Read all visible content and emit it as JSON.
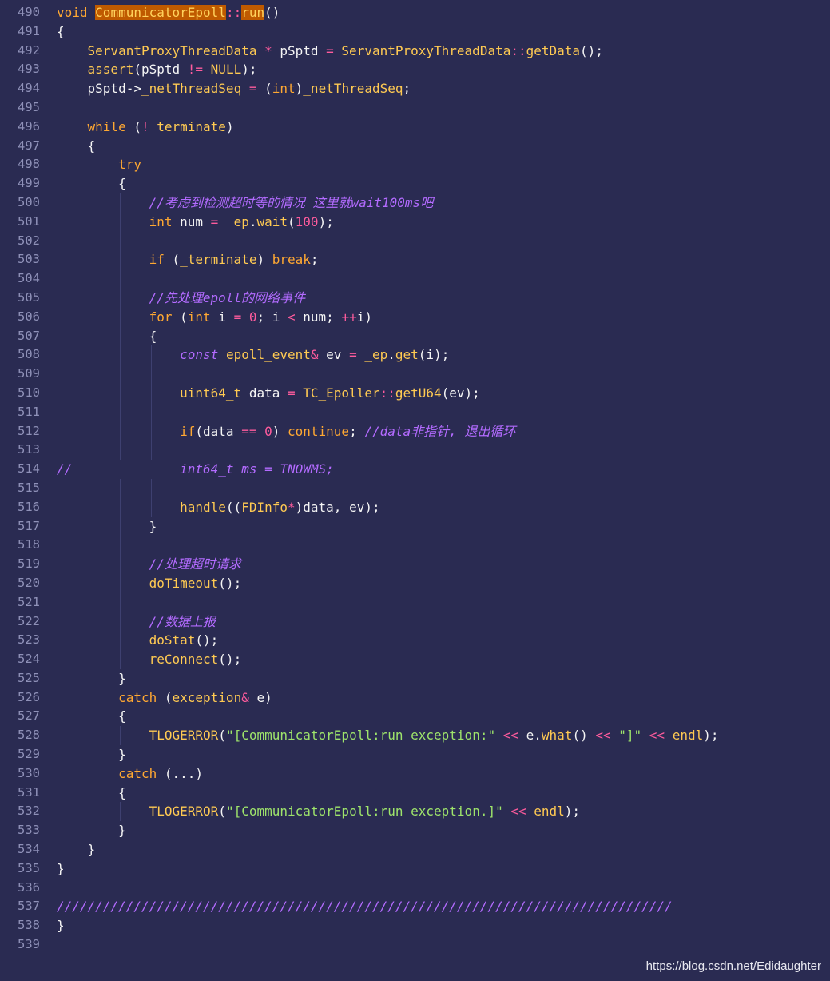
{
  "editor": {
    "background": "#2a2b52",
    "lines": [
      {
        "num": "490",
        "indent": 0,
        "tokens": [
          [
            "void ",
            "kw"
          ],
          [
            "CommunicatorEpoll",
            "hl"
          ],
          [
            "::",
            "op"
          ],
          [
            "run",
            "hl"
          ],
          [
            "()",
            "punct"
          ]
        ]
      },
      {
        "num": "491",
        "indent": 0,
        "tokens": [
          [
            "{",
            "punct"
          ]
        ]
      },
      {
        "num": "492",
        "indent": 1,
        "tokens": [
          [
            "    ",
            "plain"
          ],
          [
            "ServantProxyThreadData",
            "fn"
          ],
          [
            " * ",
            "op"
          ],
          [
            "pSptd ",
            "plain"
          ],
          [
            "= ",
            "op"
          ],
          [
            "ServantProxyThreadData",
            "fn"
          ],
          [
            "::",
            "op"
          ],
          [
            "getData",
            "fn"
          ],
          [
            "();",
            "punct"
          ]
        ]
      },
      {
        "num": "493",
        "indent": 1,
        "tokens": [
          [
            "    ",
            "plain"
          ],
          [
            "assert",
            "fn"
          ],
          [
            "(pSptd ",
            "plain"
          ],
          [
            "!= ",
            "op"
          ],
          [
            "NULL",
            "fn"
          ],
          [
            ");",
            "punct"
          ]
        ]
      },
      {
        "num": "494",
        "indent": 1,
        "tokens": [
          [
            "    ",
            "plain"
          ],
          [
            "pSptd->",
            "plain"
          ],
          [
            "_netThreadSeq",
            "fn"
          ],
          [
            " = ",
            "op"
          ],
          [
            "(",
            "punct"
          ],
          [
            "int",
            "type"
          ],
          [
            ")",
            "punct"
          ],
          [
            "_netThreadSeq",
            "fn"
          ],
          [
            ";",
            "punct"
          ]
        ]
      },
      {
        "num": "495",
        "indent": 0,
        "tokens": []
      },
      {
        "num": "496",
        "indent": 1,
        "tokens": [
          [
            "    ",
            "plain"
          ],
          [
            "while",
            "kw"
          ],
          [
            " (",
            "punct"
          ],
          [
            "!",
            "op"
          ],
          [
            "_terminate",
            "fn"
          ],
          [
            ")",
            "punct"
          ]
        ]
      },
      {
        "num": "497",
        "indent": 1,
        "tokens": [
          [
            "    ",
            "plain"
          ],
          [
            "{",
            "punct"
          ]
        ]
      },
      {
        "num": "498",
        "indent": 2,
        "tokens": [
          [
            "        ",
            "plain"
          ],
          [
            "try",
            "kw"
          ]
        ]
      },
      {
        "num": "499",
        "indent": 2,
        "tokens": [
          [
            "        ",
            "plain"
          ],
          [
            "{",
            "punct"
          ]
        ]
      },
      {
        "num": "500",
        "indent": 3,
        "tokens": [
          [
            "            ",
            "plain"
          ],
          [
            "//考虑到检测超时等的情况 这里就wait100ms吧",
            "cmt"
          ]
        ]
      },
      {
        "num": "501",
        "indent": 3,
        "tokens": [
          [
            "            ",
            "plain"
          ],
          [
            "int",
            "type"
          ],
          [
            " num ",
            "plain"
          ],
          [
            "= ",
            "op"
          ],
          [
            "_ep",
            "fn"
          ],
          [
            ".",
            "punct"
          ],
          [
            "wait",
            "fn"
          ],
          [
            "(",
            "punct"
          ],
          [
            "100",
            "num"
          ],
          [
            ");",
            "punct"
          ]
        ]
      },
      {
        "num": "502",
        "indent": 3,
        "tokens": []
      },
      {
        "num": "503",
        "indent": 3,
        "tokens": [
          [
            "            ",
            "plain"
          ],
          [
            "if",
            "kw"
          ],
          [
            " (",
            "punct"
          ],
          [
            "_terminate",
            "fn"
          ],
          [
            ") ",
            "punct"
          ],
          [
            "break",
            "kw"
          ],
          [
            ";",
            "punct"
          ]
        ]
      },
      {
        "num": "504",
        "indent": 3,
        "tokens": []
      },
      {
        "num": "505",
        "indent": 3,
        "tokens": [
          [
            "            ",
            "plain"
          ],
          [
            "//先处理epoll的网络事件",
            "cmt"
          ]
        ]
      },
      {
        "num": "506",
        "indent": 3,
        "tokens": [
          [
            "            ",
            "plain"
          ],
          [
            "for",
            "kw"
          ],
          [
            " (",
            "punct"
          ],
          [
            "int",
            "type"
          ],
          [
            " i ",
            "plain"
          ],
          [
            "= ",
            "op"
          ],
          [
            "0",
            "num"
          ],
          [
            "; i ",
            "plain"
          ],
          [
            "< ",
            "op"
          ],
          [
            "num; ",
            "plain"
          ],
          [
            "++",
            "op"
          ],
          [
            "i)",
            "plain"
          ]
        ]
      },
      {
        "num": "507",
        "indent": 3,
        "tokens": [
          [
            "            ",
            "plain"
          ],
          [
            "{",
            "punct"
          ]
        ]
      },
      {
        "num": "508",
        "indent": 4,
        "tokens": [
          [
            "                ",
            "plain"
          ],
          [
            "const",
            "cmt"
          ],
          [
            " ",
            "plain"
          ],
          [
            "epoll_event",
            "fn"
          ],
          [
            "& ",
            "op"
          ],
          [
            "ev ",
            "plain"
          ],
          [
            "= ",
            "op"
          ],
          [
            "_ep",
            "fn"
          ],
          [
            ".",
            "punct"
          ],
          [
            "get",
            "fn"
          ],
          [
            "(i);",
            "punct"
          ]
        ]
      },
      {
        "num": "509",
        "indent": 4,
        "tokens": []
      },
      {
        "num": "510",
        "indent": 4,
        "tokens": [
          [
            "                ",
            "plain"
          ],
          [
            "uint64_t",
            "fn"
          ],
          [
            " data ",
            "plain"
          ],
          [
            "= ",
            "op"
          ],
          [
            "TC_Epoller",
            "fn"
          ],
          [
            "::",
            "op"
          ],
          [
            "getU64",
            "fn"
          ],
          [
            "(ev);",
            "punct"
          ]
        ]
      },
      {
        "num": "511",
        "indent": 4,
        "tokens": []
      },
      {
        "num": "512",
        "indent": 4,
        "tokens": [
          [
            "                ",
            "plain"
          ],
          [
            "if",
            "kw"
          ],
          [
            "(data ",
            "plain"
          ],
          [
            "== ",
            "op"
          ],
          [
            "0",
            "num"
          ],
          [
            ") ",
            "punct"
          ],
          [
            "continue",
            "kw"
          ],
          [
            "; ",
            "punct"
          ],
          [
            "//data非指针, 退出循环",
            "cmt"
          ]
        ]
      },
      {
        "num": "513",
        "indent": 4,
        "tokens": []
      },
      {
        "num": "514",
        "indent": 0,
        "tokens": [
          [
            "//              int64_t ms = TNOWMS;",
            "cmt"
          ]
        ]
      },
      {
        "num": "515",
        "indent": 4,
        "tokens": []
      },
      {
        "num": "516",
        "indent": 4,
        "tokens": [
          [
            "                ",
            "plain"
          ],
          [
            "handle",
            "fn"
          ],
          [
            "((",
            "punct"
          ],
          [
            "FDInfo",
            "fn"
          ],
          [
            "*",
            "op"
          ],
          [
            ")data, ev);",
            "punct"
          ]
        ]
      },
      {
        "num": "517",
        "indent": 3,
        "tokens": [
          [
            "            ",
            "plain"
          ],
          [
            "}",
            "punct"
          ]
        ]
      },
      {
        "num": "518",
        "indent": 3,
        "tokens": []
      },
      {
        "num": "519",
        "indent": 3,
        "tokens": [
          [
            "            ",
            "plain"
          ],
          [
            "//处理超时请求",
            "cmt"
          ]
        ]
      },
      {
        "num": "520",
        "indent": 3,
        "tokens": [
          [
            "            ",
            "plain"
          ],
          [
            "doTimeout",
            "fn"
          ],
          [
            "();",
            "punct"
          ]
        ]
      },
      {
        "num": "521",
        "indent": 3,
        "tokens": []
      },
      {
        "num": "522",
        "indent": 3,
        "tokens": [
          [
            "            ",
            "plain"
          ],
          [
            "//数据上报",
            "cmt"
          ]
        ]
      },
      {
        "num": "523",
        "indent": 3,
        "tokens": [
          [
            "            ",
            "plain"
          ],
          [
            "doStat",
            "fn"
          ],
          [
            "();",
            "punct"
          ]
        ]
      },
      {
        "num": "524",
        "indent": 3,
        "tokens": [
          [
            "            ",
            "plain"
          ],
          [
            "reConnect",
            "fn"
          ],
          [
            "();",
            "punct"
          ]
        ]
      },
      {
        "num": "525",
        "indent": 2,
        "tokens": [
          [
            "        ",
            "plain"
          ],
          [
            "}",
            "punct"
          ]
        ]
      },
      {
        "num": "526",
        "indent": 2,
        "tokens": [
          [
            "        ",
            "plain"
          ],
          [
            "catch",
            "kw"
          ],
          [
            " (",
            "punct"
          ],
          [
            "exception",
            "fn"
          ],
          [
            "& ",
            "op"
          ],
          [
            "e)",
            "plain"
          ]
        ]
      },
      {
        "num": "527",
        "indent": 2,
        "tokens": [
          [
            "        ",
            "plain"
          ],
          [
            "{",
            "punct"
          ]
        ]
      },
      {
        "num": "528",
        "indent": 3,
        "tokens": [
          [
            "            ",
            "plain"
          ],
          [
            "TLOGERROR",
            "fn"
          ],
          [
            "(",
            "punct"
          ],
          [
            "\"[CommunicatorEpoll:run exception:\"",
            "str"
          ],
          [
            " ",
            "plain"
          ],
          [
            "<<",
            "op"
          ],
          [
            " e.",
            "plain"
          ],
          [
            "what",
            "fn"
          ],
          [
            "() ",
            "punct"
          ],
          [
            "<<",
            "op"
          ],
          [
            " ",
            "plain"
          ],
          [
            "\"]\"",
            "str"
          ],
          [
            " ",
            "plain"
          ],
          [
            "<<",
            "op"
          ],
          [
            " ",
            "plain"
          ],
          [
            "endl",
            "fn"
          ],
          [
            ");",
            "punct"
          ]
        ]
      },
      {
        "num": "529",
        "indent": 2,
        "tokens": [
          [
            "        ",
            "plain"
          ],
          [
            "}",
            "punct"
          ]
        ]
      },
      {
        "num": "530",
        "indent": 2,
        "tokens": [
          [
            "        ",
            "plain"
          ],
          [
            "catch",
            "kw"
          ],
          [
            " (...)",
            "punct"
          ]
        ]
      },
      {
        "num": "531",
        "indent": 2,
        "tokens": [
          [
            "        ",
            "plain"
          ],
          [
            "{",
            "punct"
          ]
        ]
      },
      {
        "num": "532",
        "indent": 3,
        "tokens": [
          [
            "            ",
            "plain"
          ],
          [
            "TLOGERROR",
            "fn"
          ],
          [
            "(",
            "punct"
          ],
          [
            "\"[CommunicatorEpoll:run exception.]\"",
            "str"
          ],
          [
            " ",
            "plain"
          ],
          [
            "<<",
            "op"
          ],
          [
            " ",
            "plain"
          ],
          [
            "endl",
            "fn"
          ],
          [
            ");",
            "punct"
          ]
        ]
      },
      {
        "num": "533",
        "indent": 2,
        "tokens": [
          [
            "        ",
            "plain"
          ],
          [
            "}",
            "punct"
          ]
        ]
      },
      {
        "num": "534",
        "indent": 1,
        "tokens": [
          [
            "    ",
            "plain"
          ],
          [
            "}",
            "punct"
          ]
        ]
      },
      {
        "num": "535",
        "indent": 0,
        "tokens": [
          [
            "}",
            "punct"
          ]
        ]
      },
      {
        "num": "536",
        "indent": 0,
        "tokens": []
      },
      {
        "num": "537",
        "indent": 0,
        "tokens": [
          [
            "////////////////////////////////////////////////////////////////////////////////",
            "cmt"
          ]
        ]
      },
      {
        "num": "538",
        "indent": 0,
        "tokens": [
          [
            "}",
            "punct"
          ]
        ]
      },
      {
        "num": "539",
        "indent": 0,
        "tokens": []
      }
    ]
  },
  "watermark": "https://blog.csdn.net/Edidaughter"
}
